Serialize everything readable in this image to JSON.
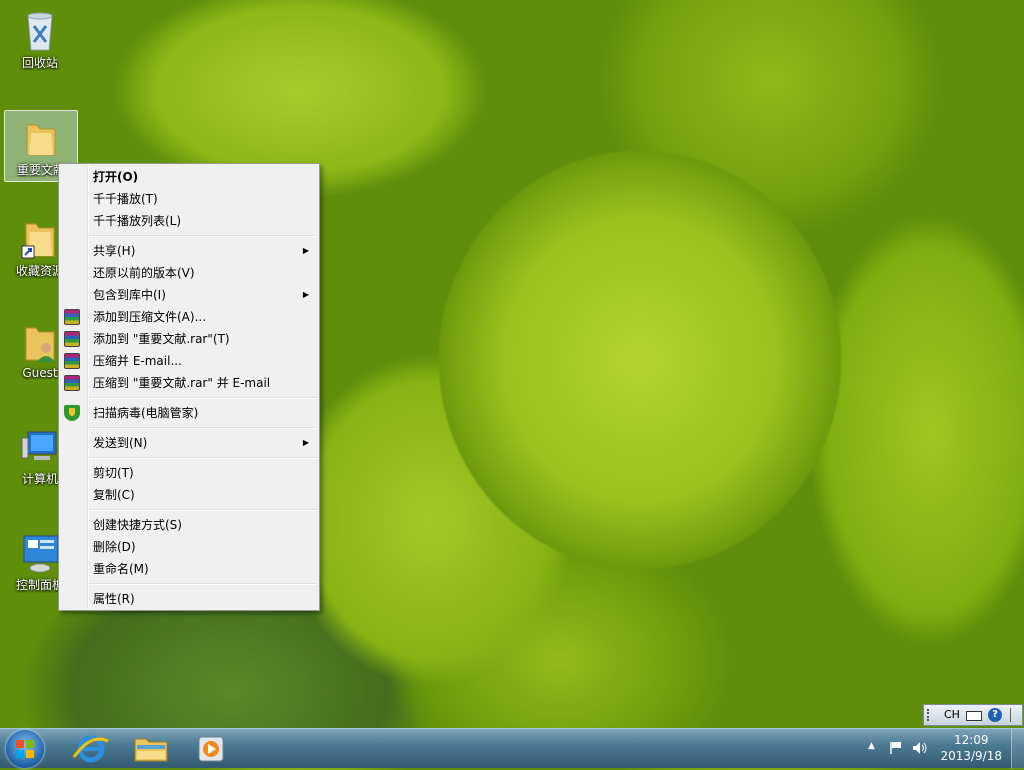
{
  "desktop": {
    "icons": [
      {
        "label": "回收站"
      },
      {
        "label": "重要文献"
      },
      {
        "label": "收藏资源"
      },
      {
        "label": "Guest"
      },
      {
        "label": "计算机"
      },
      {
        "label": "控制面板"
      }
    ]
  },
  "context_menu": {
    "items": [
      {
        "label": "打开(O)"
      },
      {
        "label": "千千播放(T)"
      },
      {
        "label": "千千播放列表(L)"
      },
      {
        "label": "共享(H)"
      },
      {
        "label": "还原以前的版本(V)"
      },
      {
        "label": "包含到库中(I)"
      },
      {
        "label": "添加到压缩文件(A)..."
      },
      {
        "label": "添加到 \"重要文献.rar\"(T)"
      },
      {
        "label": "压缩并 E-mail..."
      },
      {
        "label": "压缩到 \"重要文献.rar\" 并 E-mail"
      },
      {
        "label": "扫描病毒(电脑管家)"
      },
      {
        "label": "发送到(N)"
      },
      {
        "label": "剪切(T)"
      },
      {
        "label": "复制(C)"
      },
      {
        "label": "创建快捷方式(S)"
      },
      {
        "label": "删除(D)"
      },
      {
        "label": "重命名(M)"
      },
      {
        "label": "属性(R)"
      }
    ],
    "submenu_arrow": "▶"
  },
  "langbar": {
    "lang": "CH"
  },
  "taskbar": {
    "clock_time": "12:09",
    "clock_date": "2013/9/18",
    "tray_arrow": "▲"
  }
}
